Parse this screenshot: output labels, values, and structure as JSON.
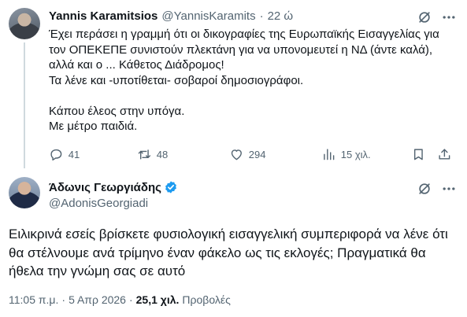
{
  "parent_tweet": {
    "author_name": "Yannis Karamitsios",
    "author_handle": "@YannisKaramits",
    "separator": "·",
    "time_ago": "22 ώ",
    "body_lines": [
      "Έχει περάσει η γραμμή ότι οι δικογραφίες της Ευρωπαϊκής Εισαγγελίας για τον ΟΠΕΚΕΠΕ συνιστούν πλεκτάνη για να υπονομευτεί η ΝΔ (άντε καλά), αλλά και ο ... Κάθετος Διάδρομος!",
      "Τα λένε και -υποτίθεται- σοβαροί δημοσιογράφοι.",
      "",
      "Κάπου έλεος στην υπόγα.",
      "Με μέτρο παιδιά."
    ],
    "stats": {
      "replies": "41",
      "reposts": "48",
      "likes": "294",
      "views": "15 χιλ."
    }
  },
  "main_tweet": {
    "author_name": "Άδωνις Γεωργιάδης",
    "author_handle": "@AdonisGeorgiadi",
    "verified_color": "#1d9bf0",
    "body": "Ειλικρινά εσείς βρίσκετε φυσιολογική εισαγγελική συμπεριφορά να λένε ότι θα στέλνουμε ανά τρίμηνο έναν φάκελο ως τις εκλογές; Πραγματικά θα ήθελα την γνώμη σας σε αυτό",
    "time": "11:05 π.μ.",
    "date": "5 Απρ 2026",
    "separator": "·",
    "views_count": "25,1 χιλ.",
    "views_label": "Προβολές"
  },
  "icons": {
    "grok": "grok-icon",
    "more": "more-icon",
    "reply": "reply-icon",
    "repost": "repost-icon",
    "like": "like-icon",
    "views": "views-icon",
    "bookmark": "bookmark-icon",
    "share": "share-icon",
    "verified": "verified-badge-icon"
  },
  "colors": {
    "text": "#0f1419",
    "secondary": "#536471",
    "accent": "#1d9bf0",
    "thread_line": "#cfd9de"
  }
}
